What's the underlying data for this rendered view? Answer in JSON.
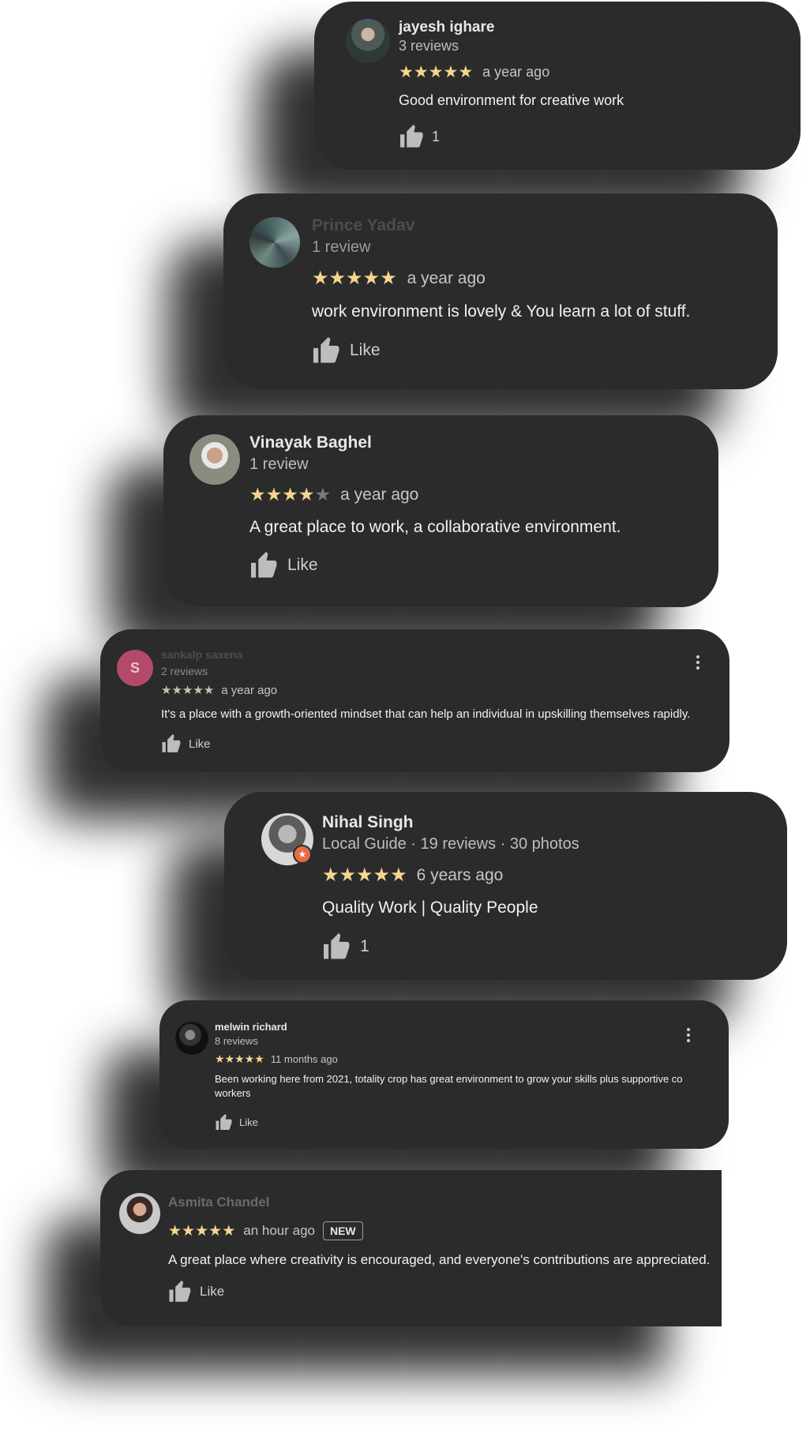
{
  "reviews": [
    {
      "name": "jayesh ighare",
      "meta": "3 reviews",
      "stars": 5,
      "time": "a year ago",
      "text": "Good environment for creative work",
      "like_label": "1"
    },
    {
      "name": "Prince Yadav",
      "meta": "1 review",
      "stars": 5,
      "time": "a year ago",
      "text": "work environment is lovely & You learn a lot of stuff.",
      "like_label": "Like"
    },
    {
      "name": "Vinayak Baghel",
      "meta": "1 review",
      "stars": 4,
      "time": "a year ago",
      "text": "A great place to work, a collaborative environment.",
      "like_label": "Like"
    },
    {
      "name": "sankalp saxena",
      "avatar_letter": "S",
      "meta": "2 reviews",
      "stars": 5,
      "time": "a year ago",
      "text": "It's a place with a growth-oriented mindset that can help an individual in upskilling themselves rapidly.",
      "like_label": "Like"
    },
    {
      "name": "Nihal Singh",
      "meta": "Local Guide · 19 reviews · 30 photos",
      "guide_badge": "★",
      "stars": 5,
      "time": "6 years ago",
      "text": "Quality Work | Quality People",
      "like_label": "1"
    },
    {
      "name": "melwin richard",
      "meta": "8 reviews",
      "stars": 5,
      "time": "11 months ago",
      "text_line1": "Been working here from 2021, totality crop has great environment to grow your skills plus supportive  co",
      "text_line2": "workers",
      "like_label": "Like"
    },
    {
      "name": "Asmita Chandel",
      "stars": 5,
      "time": "an hour ago",
      "badge": "NEW",
      "text": "A great place where creativity is encouraged, and everyone's contributions are appreciated.",
      "like_label": "Like"
    }
  ],
  "colors": {
    "card_bg": "#2b2b2b",
    "star": "#f6d58e",
    "star_off": "#7a7a7a",
    "avatar_letter_bg": "#b44a6a"
  }
}
